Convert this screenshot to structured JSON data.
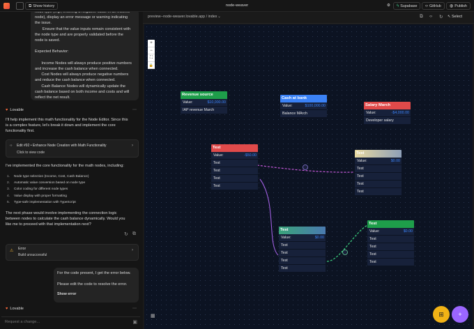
{
  "topbar": {
    "show_history": "Show history",
    "project_title": "node-weaver",
    "supabase": "Supabase",
    "github": "GitHub",
    "publish": "Publish"
  },
  "chat": {
    "user_msg_1": "node type (e.g., entering a negative value in an Income\nnode), display an error message or warning indicating\nthe issue.\n       Ensure that the value inputs remain consistent with\nthe node type and are properly validated before the\nnode is saved.\n\nExpected Behavior:\n\n      Income Nodes will always produce positive numbers\nand increase the cash balance when connected.\n      Cost Nodes will always produce negative numbers\nand reduce the cash balance when connected.\n      Cash Balance Nodes will dynamically update the\ncash balance based on both income and costs and will\nreflect the net result.",
    "sender_1": "Lovable",
    "reply_1": "I'll help implement this math functionality for the Node Editor. Since this\nis a complex feature, let's break it down and implement the core\nfunctionality first.",
    "edit_card": {
      "title": "Edit #92 • Enhance Node Creation with Math Functionality",
      "sub": "Click to view code"
    },
    "reply_2": "I've implemented the core functionality for the math nodes, including:",
    "features": [
      "Node type selection (Income, Cost, Cash Balance)",
      "Automatic value conversion based on node type",
      "Color coding for different node types",
      "Value display with proper formatting",
      "Type-safe implementation with TypeScript"
    ],
    "reply_3": "The next phase would involve implementing the connection logic\nbetween nodes to calculate the cash balance dynamically. Would you\nlike me to proceed with that implementation next?",
    "error_card": {
      "title": "Error",
      "sub": "Build unsuccessful"
    },
    "user_msg_2a": "For the code present, I get the error below.",
    "user_msg_2b": "Please edit the code to resolve the error.",
    "show_error": "Show error",
    "sender_2": "Lovable",
    "input_placeholder": "Request a change..."
  },
  "preview": {
    "url": "preview--node-weaver.lovable.app / index",
    "select": "Select"
  },
  "nodes": [
    {
      "id": "revenue",
      "title": "Revenue source",
      "color": "#1e9e4a",
      "label": "Value:",
      "value": "$10,000.00",
      "value_color": "#3b82f6",
      "rows": [
        "IAP revenue March"
      ]
    },
    {
      "id": "cash",
      "title": "Cash at bank",
      "color": "#3b82f6",
      "label": "Value:",
      "value": "$100,000.00",
      "value_color": "#3b82f6",
      "rows": [
        "Balance MArch"
      ]
    },
    {
      "id": "salary",
      "title": "Salary March",
      "color": "#e04a4a",
      "label": "Value:",
      "value": "-$4,000.00",
      "value_color": "#3b82f6",
      "rows": [
        "Developer salary"
      ]
    },
    {
      "id": "test1",
      "title": "Test",
      "color": "#e04a4a",
      "label": "Value:",
      "value": "-$50.00",
      "value_color": "#3b82f6",
      "rows": [
        "Test",
        "Test",
        "Test",
        "Test"
      ]
    },
    {
      "id": "test2",
      "title": "Test",
      "color": "#c8c3a0",
      "label": "Value:",
      "value": "$0.00",
      "value_color": "#3b82f6",
      "rows": [
        "Test",
        "Test",
        "Test",
        "Test"
      ]
    },
    {
      "id": "test3",
      "title": "Test",
      "color": "#3f8d8f",
      "label": "Value:",
      "value": "$0.00",
      "value_color": "#3b82f6",
      "rows": [
        "Test",
        "Test",
        "Test",
        "Test"
      ]
    },
    {
      "id": "test4",
      "title": "Test",
      "color": "#1e9e4a",
      "label": "Value:",
      "value": "$0.00",
      "value_color": "#3b82f6",
      "rows": [
        "Test",
        "Test",
        "Test",
        "Test"
      ]
    }
  ],
  "zoom_controls": [
    "+",
    "−",
    "⛶",
    "🔒"
  ]
}
